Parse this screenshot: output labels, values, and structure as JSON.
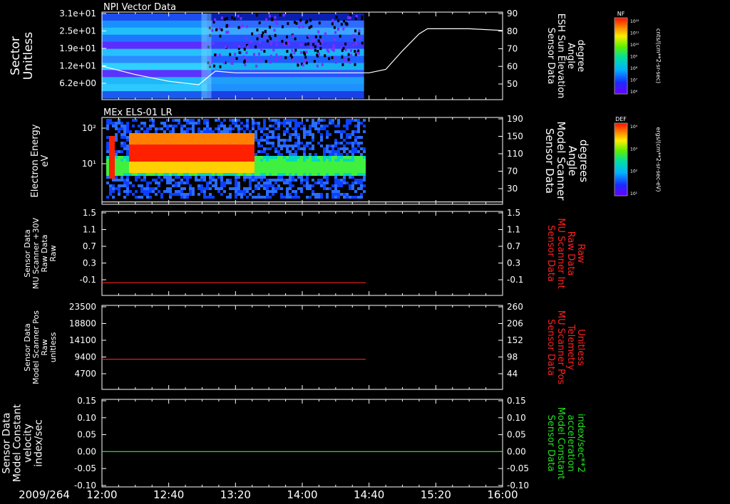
{
  "figure": {
    "date_label": "2009/264",
    "time_ticks": [
      "12:00",
      "12:40",
      "13:20",
      "14:00",
      "14:40",
      "15:20",
      "16:00"
    ]
  },
  "panels": [
    {
      "id": "npi",
      "title": "NPI Vector Data",
      "left_label": [
        "Sector",
        "Unitless"
      ],
      "left_ticks": [
        "3.1e+01",
        "2.5e+01",
        "1.9e+01",
        "1.2e+01",
        "6.2e+00"
      ],
      "right_label": [
        "Sensor Data",
        "ESH Sun Elevation",
        "Angle",
        "degree"
      ],
      "right_ticks": [
        "90",
        "80",
        "70",
        "60",
        "50"
      ],
      "right_label_color": "#ffffff",
      "colorbar": {
        "label": "NF",
        "units": "cnts/(cm**2-sr-sec)",
        "ticks": [
          "10¹²",
          "10¹¹",
          "10¹⁰",
          "10⁹",
          "10⁸",
          "10⁷",
          "10⁶"
        ]
      }
    },
    {
      "id": "els",
      "title": "MEx ELS-01 LR",
      "left_label": [
        "Electron Energy",
        "eV"
      ],
      "left_ticks": [
        "10²",
        "10¹"
      ],
      "right_label": [
        "Sensor Data",
        "Model Scanner",
        "Angle",
        "degrees"
      ],
      "right_ticks": [
        "190",
        "150",
        "110",
        "70",
        "30"
      ],
      "right_label_color": "#ffffff",
      "colorbar": {
        "label": "DEF",
        "units": "ergs/(cm**2-sr-sec-eV)",
        "ticks": [
          "10⁴",
          "10³",
          "10²",
          "10¹"
        ]
      }
    },
    {
      "id": "mu-int",
      "left_label": [
        "Sensor Data",
        "MU Scanner +30V",
        "Raw Data",
        "Raw"
      ],
      "left_ticks": [
        "1.5",
        "1.1",
        "0.7",
        "0.3",
        "-0.1"
      ],
      "right_label": [
        "Sensor Data",
        "MU Scanner Int",
        "Raw Data",
        "Raw"
      ],
      "right_ticks": [
        "1.5",
        "1.1",
        "0.7",
        "0.3",
        "-0.1"
      ],
      "right_label_color": "#ff2020"
    },
    {
      "id": "mu-pos",
      "left_label": [
        "Sensor Data",
        "Model Scanner Pos",
        "Raw",
        "unitless"
      ],
      "left_ticks": [
        "23500",
        "18800",
        "14100",
        "9400",
        "4700"
      ],
      "right_label": [
        "Sensor Data",
        "MU Scanner Pos",
        "Telemetry",
        "Unitless"
      ],
      "right_ticks": [
        "260",
        "206",
        "152",
        "98",
        "44"
      ],
      "right_label_color": "#ff2020"
    },
    {
      "id": "model-const",
      "left_label": [
        "Sensor Data",
        "Model Constant",
        "velocity",
        "index/sec"
      ],
      "left_ticks": [
        "0.15",
        "0.10",
        "0.05",
        "0.00",
        "-0.05",
        "-0.10"
      ],
      "right_label": [
        "Sensor Data",
        "Model Constant",
        "acceleration",
        "index/sec**2"
      ],
      "right_ticks": [
        "0.15",
        "0.10",
        "0.05",
        "0.00",
        "-0.05",
        "-0.10"
      ],
      "right_label_color": "#20e020"
    }
  ],
  "chart_data": [
    {
      "type": "heatmap",
      "title": "NPI Vector Data",
      "xlabel": "",
      "x_range": [
        "12:00",
        "16:00"
      ],
      "data_end": "14:37",
      "ylabel": "Sector Unitless",
      "y_tick_labels": [
        "3.1e+01",
        "2.5e+01",
        "1.9e+01",
        "1.2e+01",
        "6.2e+00"
      ],
      "colorbar": {
        "label": "NF",
        "units": "cnts/(cm**2-sr-sec)",
        "range": [
          "10⁶",
          "10¹²"
        ]
      },
      "overlay_line": {
        "name": "Sensor Data ESH Sun Elevation Angle",
        "units": "degree",
        "y_range": [
          40,
          90
        ],
        "x": [
          "12:00",
          "12:20",
          "12:40",
          "12:58",
          "13:03",
          "13:08",
          "13:20",
          "14:00",
          "14:40",
          "14:50",
          "15:00",
          "15:10",
          "15:15",
          "15:20",
          "15:40",
          "16:00"
        ],
        "y": [
          59,
          54,
          50,
          48,
          52,
          56,
          55,
          55,
          55,
          57,
          68,
          78,
          81,
          81,
          81,
          80
        ]
      }
    },
    {
      "type": "heatmap",
      "title": "MEx ELS-01 LR",
      "x_range": [
        "12:00",
        "16:00"
      ],
      "data_end": "14:37",
      "ylabel": "Electron Energy eV",
      "y_scale": "log",
      "y_tick_labels": [
        "10²",
        "10¹"
      ],
      "colorbar": {
        "label": "DEF",
        "units": "ergs/(cm**2-sr-sec-eV)",
        "range": [
          "10¹",
          "10⁴"
        ]
      },
      "overlay_line": {
        "name": "Sensor Data Model Scanner Angle",
        "units": "degrees",
        "y_range": [
          10,
          190
        ],
        "x": [
          "12:00",
          "16:00"
        ],
        "y": [
          12,
          12
        ]
      }
    },
    {
      "type": "line",
      "x_range": [
        "12:00",
        "16:00"
      ],
      "ylim": [
        -0.3,
        1.5
      ],
      "series": [
        {
          "name": "Sensor Data MU Scanner Int Raw Data",
          "color": "#ff2020",
          "x": [
            "12:00",
            "14:38"
          ],
          "y": [
            -0.05,
            -0.05
          ]
        }
      ]
    },
    {
      "type": "line",
      "x_range": [
        "12:00",
        "16:00"
      ],
      "ylim": [
        0,
        23500
      ],
      "series": [
        {
          "name": "Sensor Data MU Scanner Pos Telemetry",
          "color": "#ff2020",
          "x": [
            "12:00",
            "14:38"
          ],
          "y": [
            8300,
            8300
          ]
        }
      ]
    },
    {
      "type": "line",
      "x_range": [
        "12:00",
        "16:00"
      ],
      "ylim": [
        -0.1,
        0.15
      ],
      "series": [
        {
          "name": "Sensor Data Model Constant",
          "color": "#20e020",
          "x": [
            "12:00",
            "16:00"
          ],
          "y": [
            0.0,
            0.0
          ]
        }
      ]
    }
  ]
}
